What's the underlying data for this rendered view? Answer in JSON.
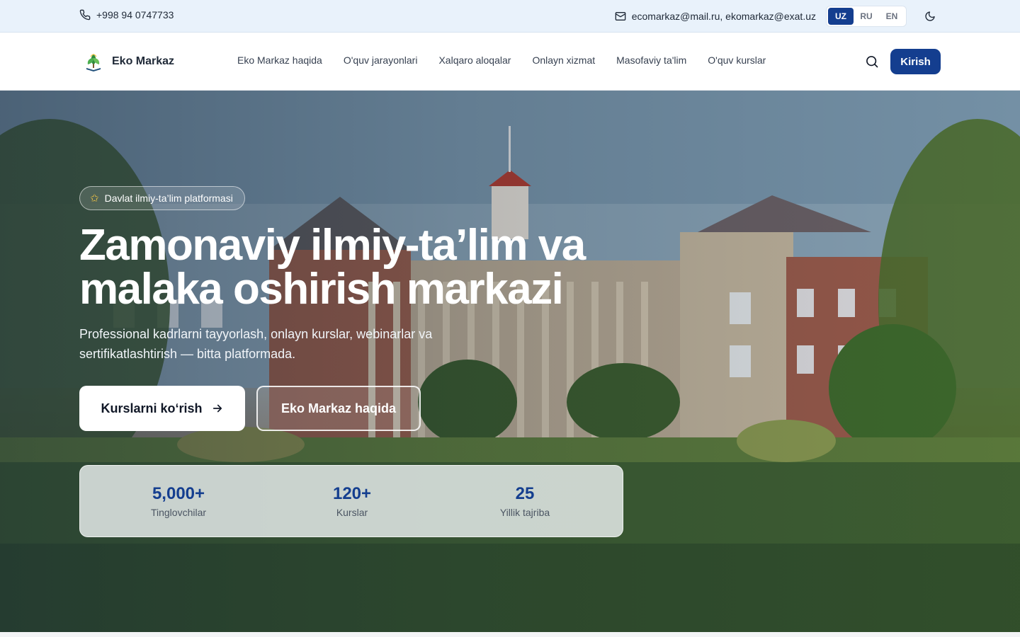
{
  "topbar": {
    "phone": "+998 94 0747733",
    "email": "ecomarkaz@mail.ru, ekomarkaz@exat.uz",
    "languages": [
      {
        "code": "UZ",
        "active": true
      },
      {
        "code": "RU",
        "active": false
      },
      {
        "code": "EN",
        "active": false
      }
    ]
  },
  "nav": {
    "brand": "Eko Markaz",
    "items": [
      "Eko Markaz haqida",
      "O'quv jarayonlari",
      "Xalqaro aloqalar",
      "Onlayn xizmat",
      "Masofaviy ta'lim",
      "O'quv kurslar"
    ],
    "login": "Kirish"
  },
  "hero": {
    "badge": "Davlat ilmiy-ta’lim platformasi",
    "title": "Zamonaviy ilmiy-ta’lim va malaka oshirish markazi",
    "subtitle": "Professional kadrlarni tayyorlash, onlayn kurslar, webinarlar va sertifikatlashtirish — bitta platformada.",
    "primary_button": "Kurslarni koʻrish",
    "secondary_button": "Eko Markaz haqida"
  },
  "stats": [
    {
      "value": "5,000+",
      "label": "Tinglovchilar"
    },
    {
      "value": "120+",
      "label": "Kurslar"
    },
    {
      "value": "25",
      "label": "Yillik tajriba"
    }
  ],
  "colors": {
    "primary": "#143e8f",
    "topbar_bg": "#e9f2fb",
    "badge_star": "#f5c542"
  }
}
